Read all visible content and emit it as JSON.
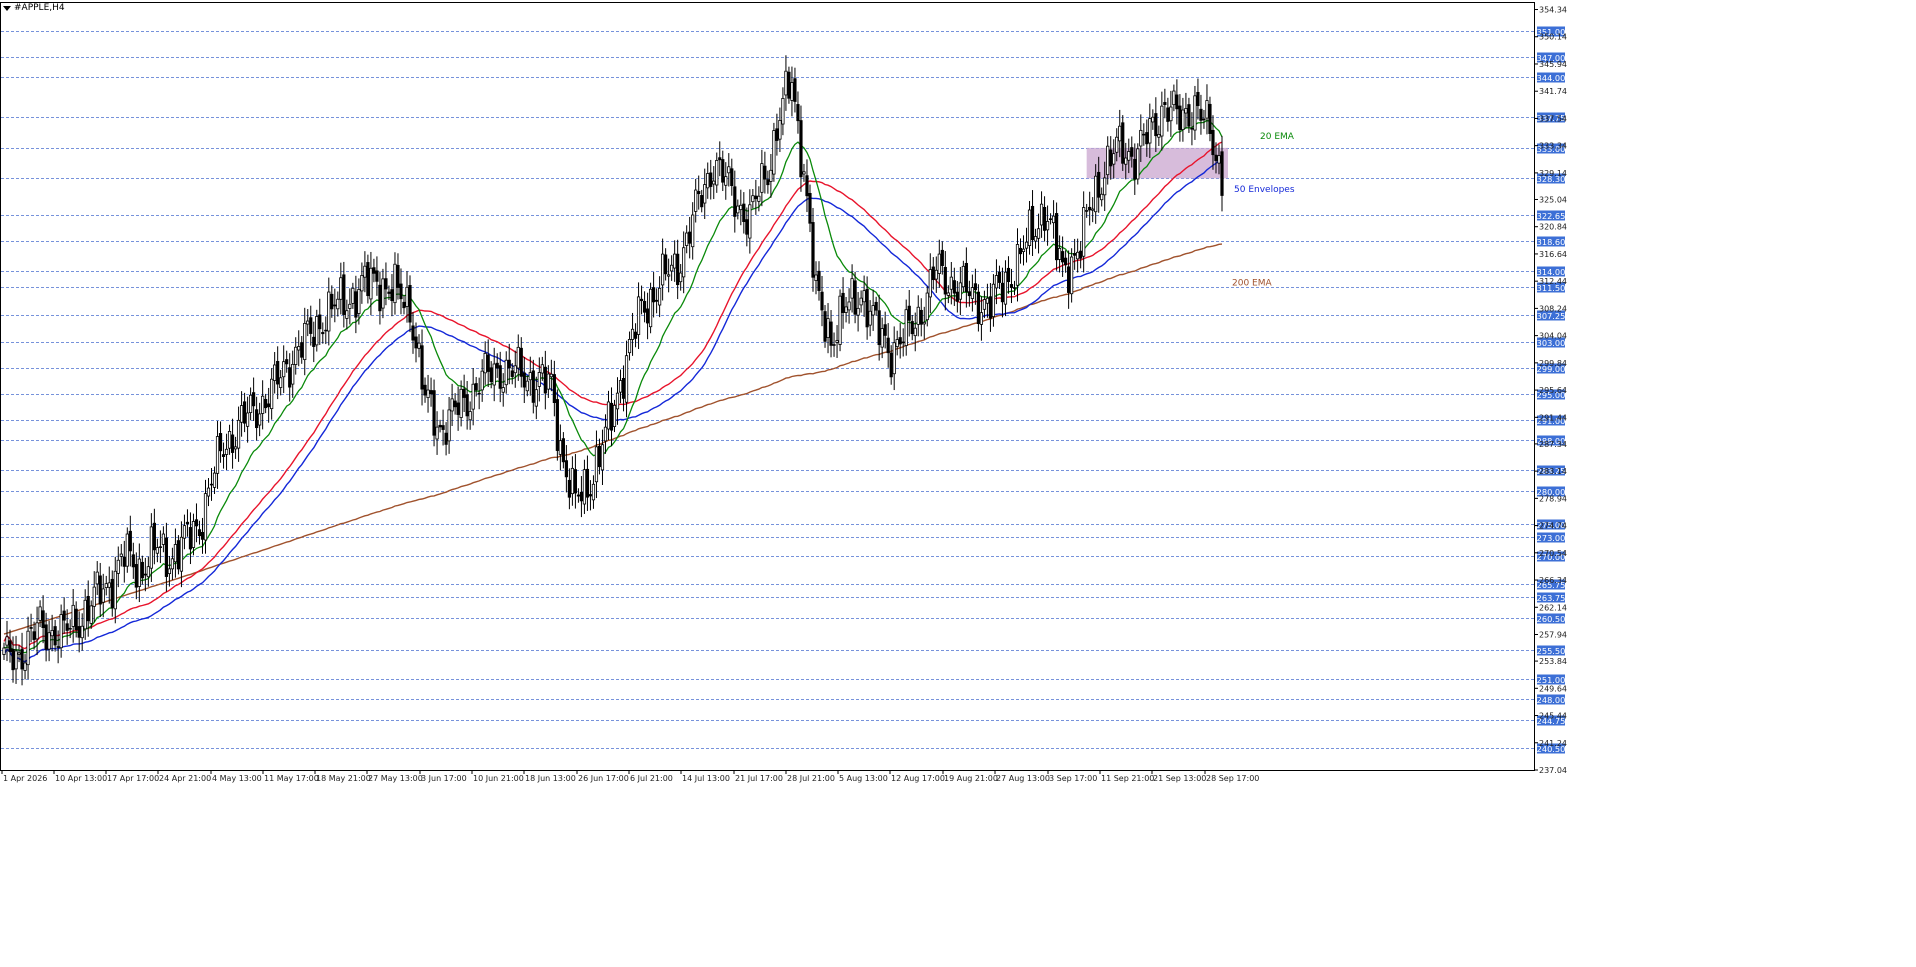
{
  "title": "#APPLE,H4",
  "colors": {
    "background": "#ffffff",
    "grid": "#4a6fd0",
    "axis": "#000000",
    "candle": "#000000",
    "ema20": "#0a8a0a",
    "env_upper": "#e8142c",
    "env_lower": "#1428d8",
    "ema200": "#a0522d",
    "highlight": "#c9a6cf",
    "label_bg": "#3c6fd6",
    "label_text": "#ffffff"
  },
  "chart_data": {
    "type": "candlestick",
    "symbol": "#APPLE",
    "timeframe": "H4",
    "ylim": [
      237.04,
      355.5
    ],
    "y_tick_labels": [
      "354.34",
      "350.14",
      "345.94",
      "341.74",
      "337.54",
      "333.34",
      "329.14",
      "325.04",
      "320.84",
      "316.64",
      "312.44",
      "308.24",
      "304.04",
      "299.84",
      "295.64",
      "291.44",
      "287.34",
      "283.14",
      "278.94",
      "274.74",
      "270.54",
      "266.34",
      "262.14",
      "257.94",
      "253.84",
      "249.64",
      "245.44",
      "241.24",
      "237.04"
    ],
    "horizontal_levels": [
      "351.00",
      "347.00",
      "344.00",
      "337.75",
      "333.00",
      "328.30",
      "322.65",
      "318.60",
      "314.00",
      "311.50",
      "307.25",
      "303.00",
      "299.00",
      "295.00",
      "291.00",
      "288.00",
      "283.25",
      "280.00",
      "275.00",
      "273.00",
      "270.00",
      "265.75",
      "263.75",
      "260.50",
      "255.50",
      "251.00",
      "248.00",
      "244.75",
      "240.50"
    ],
    "x_tick_labels": [
      "1 Apr 2026",
      "10 Apr 13:00",
      "17 Apr 17:00",
      "24 Apr 21:00",
      "4 May 13:00",
      "11 May 17:00",
      "18 May 21:00",
      "27 May 13:00",
      "3 Jun 17:00",
      "10 Jun 21:00",
      "18 Jun 13:00",
      "26 Jun 17:00",
      "6 Jul 21:00",
      "14 Jul 13:00",
      "21 Jul 17:00",
      "28 Jul 21:00",
      "5 Aug 13:00",
      "12 Aug 17:00",
      "19 Aug 21:00",
      "27 Aug 13:00",
      "3 Sep 17:00",
      "11 Sep 21:00",
      "21 Sep 13:00",
      "28 Sep 17:00"
    ],
    "price_anchors": [
      [
        0,
        254
      ],
      [
        5,
        255
      ],
      [
        12,
        259
      ],
      [
        20,
        258
      ],
      [
        28,
        262
      ],
      [
        35,
        266
      ],
      [
        40,
        270
      ],
      [
        45,
        268
      ],
      [
        50,
        271
      ],
      [
        55,
        270
      ],
      [
        60,
        272
      ],
      [
        65,
        275
      ],
      [
        68,
        280
      ],
      [
        73,
        287
      ],
      [
        78,
        290
      ],
      [
        84,
        293
      ],
      [
        90,
        296
      ],
      [
        96,
        301
      ],
      [
        102,
        304
      ],
      [
        106,
        307
      ],
      [
        112,
        309
      ],
      [
        118,
        311
      ],
      [
        124,
        313
      ],
      [
        128,
        311
      ],
      [
        132,
        310
      ],
      [
        135,
        309
      ],
      [
        140,
        294
      ],
      [
        145,
        290
      ],
      [
        152,
        293
      ],
      [
        158,
        297
      ],
      [
        165,
        299
      ],
      [
        172,
        298
      ],
      [
        178,
        297
      ],
      [
        182,
        296
      ],
      [
        186,
        285
      ],
      [
        190,
        278
      ],
      [
        195,
        282
      ],
      [
        200,
        288
      ],
      [
        206,
        299
      ],
      [
        212,
        308
      ],
      [
        218,
        312
      ],
      [
        224,
        315
      ],
      [
        230,
        323
      ],
      [
        236,
        331
      ],
      [
        242,
        326
      ],
      [
        248,
        322
      ],
      [
        254,
        330
      ],
      [
        258,
        338
      ],
      [
        262,
        343
      ],
      [
        266,
        330
      ],
      [
        270,
        310
      ],
      [
        275,
        304
      ],
      [
        280,
        308
      ],
      [
        285,
        311
      ],
      [
        290,
        305
      ],
      [
        295,
        302
      ],
      [
        300,
        304
      ],
      [
        305,
        308
      ],
      [
        310,
        314
      ],
      [
        316,
        312
      ],
      [
        322,
        310
      ],
      [
        328,
        309
      ],
      [
        334,
        313
      ],
      [
        340,
        318
      ],
      [
        346,
        324
      ],
      [
        352,
        314
      ],
      [
        358,
        318
      ],
      [
        362,
        325
      ],
      [
        366,
        330
      ],
      [
        371,
        333
      ],
      [
        376,
        332
      ],
      [
        381,
        335
      ],
      [
        386,
        340
      ],
      [
        391,
        337
      ],
      [
        396,
        340
      ],
      [
        400,
        336
      ],
      [
        403,
        332
      ],
      [
        405,
        329
      ]
    ],
    "series": [
      {
        "name": "20 EMA",
        "type": "ema",
        "period": 20
      },
      {
        "name": "50 Envelopes",
        "type": "envelope",
        "period": 50
      },
      {
        "name": "200 EMA",
        "type": "ema",
        "period": 200
      }
    ],
    "highlight_zone": {
      "y_range": [
        328.3,
        333.0
      ]
    },
    "grid": true
  }
}
